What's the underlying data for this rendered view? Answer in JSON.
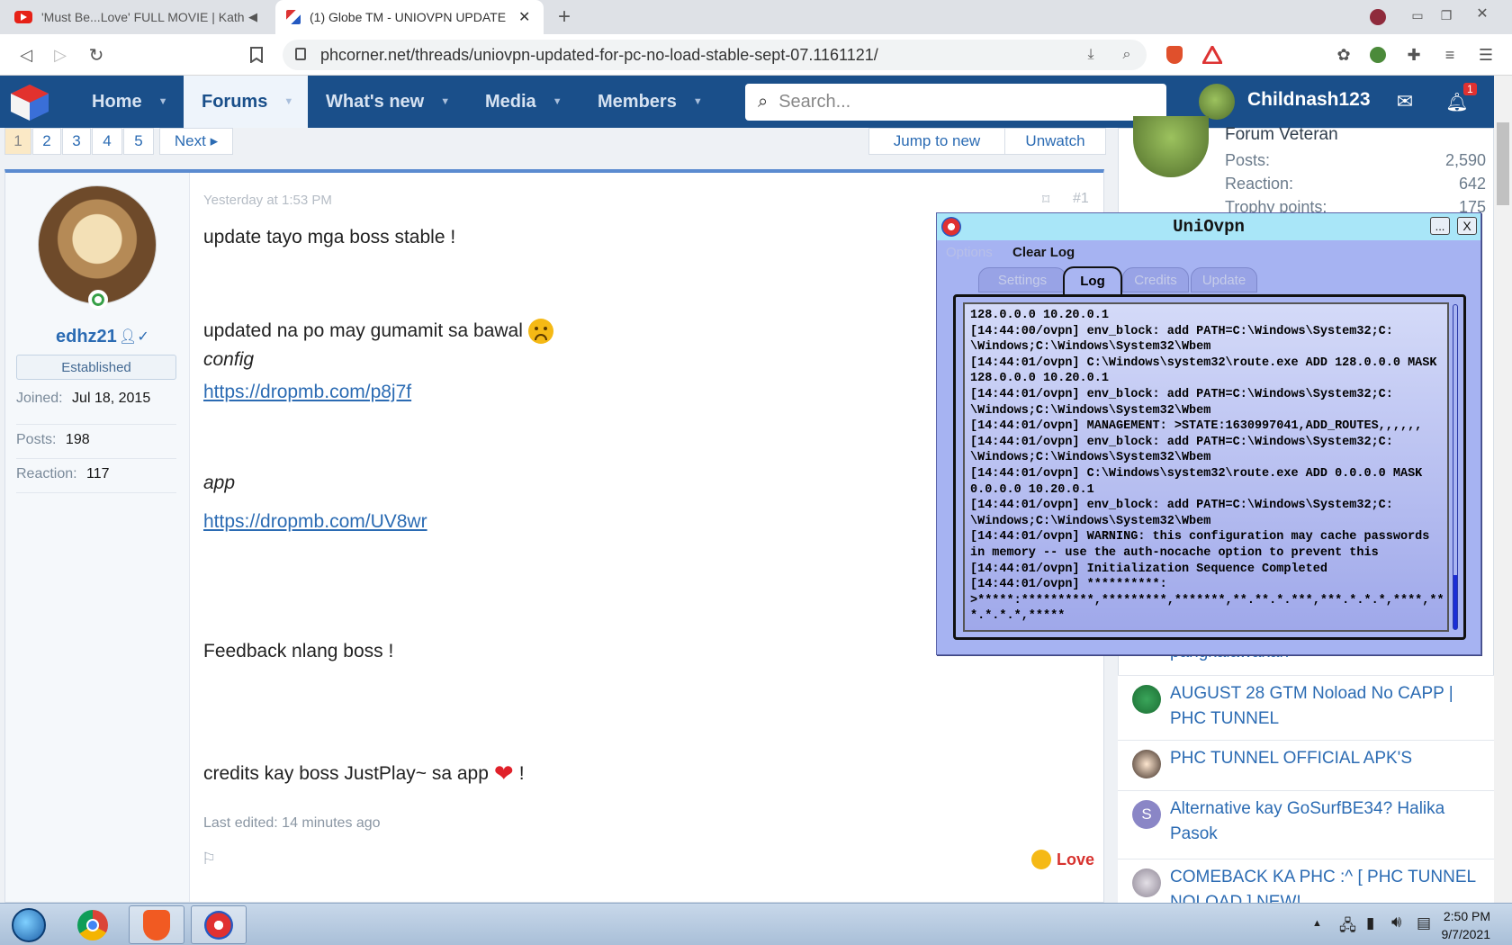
{
  "browser": {
    "tabs": [
      {
        "title": "'Must Be...Love' FULL MOVIE | Kath",
        "audio": true
      },
      {
        "title": "(1) Globe TM - UNIOVPN UPDATE",
        "active": true
      }
    ],
    "url": "phcorner.net/threads/uniovpn-updated-for-pc-no-load-stable-sept-07.1161121/"
  },
  "site": {
    "nav": [
      "Home",
      "Forums",
      "What's new",
      "Media",
      "Members"
    ],
    "active_nav": "Forums",
    "search_placeholder": "Search...",
    "username": "Childnash123",
    "notif_count": "1"
  },
  "pagination": {
    "pages": [
      "1",
      "2",
      "3",
      "4",
      "5"
    ],
    "next": "Next",
    "jump": "Jump to new",
    "unwatch": "Unwatch"
  },
  "post": {
    "author": "edhz21",
    "rank": "Established",
    "joined_label": "Joined:",
    "joined": "Jul 18, 2015",
    "posts_label": "Posts:",
    "posts": "198",
    "reaction_label": "Reaction:",
    "reaction": "117",
    "time": "Yesterday at 1:53 PM",
    "number": "#1",
    "line1": "update tayo mga boss stable !",
    "line2": "updated na po may gumamit sa bawal",
    "config_label": "config",
    "config_link": "https://dropmb.com/p8j7f",
    "app_label": "app",
    "app_link": "https://dropmb.com/UV8wr",
    "feedback": "Feedback nlang boss !",
    "credits": "credits kay boss JustPlay~ sa app",
    "credits_end": "!",
    "edited": "Last edited: 14 minutes ago",
    "reaction_word": "Love"
  },
  "sidebar": {
    "title": "Forum Veteran",
    "stats": [
      {
        "label": "Posts:",
        "value": "2,590"
      },
      {
        "label": "Reaction:",
        "value": "642"
      },
      {
        "label": "Trophy points:",
        "value": "175"
      }
    ],
    "partial_title": "pangkalawakan",
    "threads": [
      {
        "title": "AUGUST 28 GTM Noload No CAPP | PHC TUNNEL"
      },
      {
        "title": "PHC TUNNEL OFFICIAL APK'S"
      },
      {
        "title": "Alternative kay GoSurfBE34? Halika Pasok",
        "initial": "S"
      },
      {
        "title": "COMEBACK KA PHC :^ [ PHC TUNNEL NOLOAD ] NEW!"
      }
    ]
  },
  "uniovpn": {
    "title": "UniOvpn",
    "minimize": "...",
    "close": "X",
    "menu": [
      "Options",
      "Clear Log"
    ],
    "tabs": [
      "Settings",
      "Log",
      "Credits",
      "Update"
    ],
    "active_tab": "Log",
    "log": "128.0.0.0 10.20.0.1\n[14:44:00/ovpn] env_block: add PATH=C:\\Windows\\System32;C:\n\\Windows;C:\\Windows\\System32\\Wbem\n[14:44:01/ovpn] C:\\Windows\\system32\\route.exe ADD 128.0.0.0 MASK\n128.0.0.0 10.20.0.1\n[14:44:01/ovpn] env_block: add PATH=C:\\Windows\\System32;C:\n\\Windows;C:\\Windows\\System32\\Wbem\n[14:44:01/ovpn] MANAGEMENT: >STATE:1630997041,ADD_ROUTES,,,,,,\n[14:44:01/ovpn] env_block: add PATH=C:\\Windows\\System32;C:\n\\Windows;C:\\Windows\\System32\\Wbem\n[14:44:01/ovpn] C:\\Windows\\system32\\route.exe ADD 0.0.0.0 MASK\n0.0.0.0 10.20.0.1\n[14:44:01/ovpn] env_block: add PATH=C:\\Windows\\System32;C:\n\\Windows;C:\\Windows\\System32\\Wbem\n[14:44:01/ovpn] WARNING: this configuration may cache passwords\nin memory -- use the auth-nocache option to prevent this\n[14:44:01/ovpn] Initialization Sequence Completed\n[14:44:01/ovpn] **********:\n>*****:**********,*********,*******,**.**.*.***,***.*.*.*,****,**\n*.*.*.*,*****"
  },
  "taskbar": {
    "time": "2:50 PM",
    "date": "9/7/2021"
  }
}
